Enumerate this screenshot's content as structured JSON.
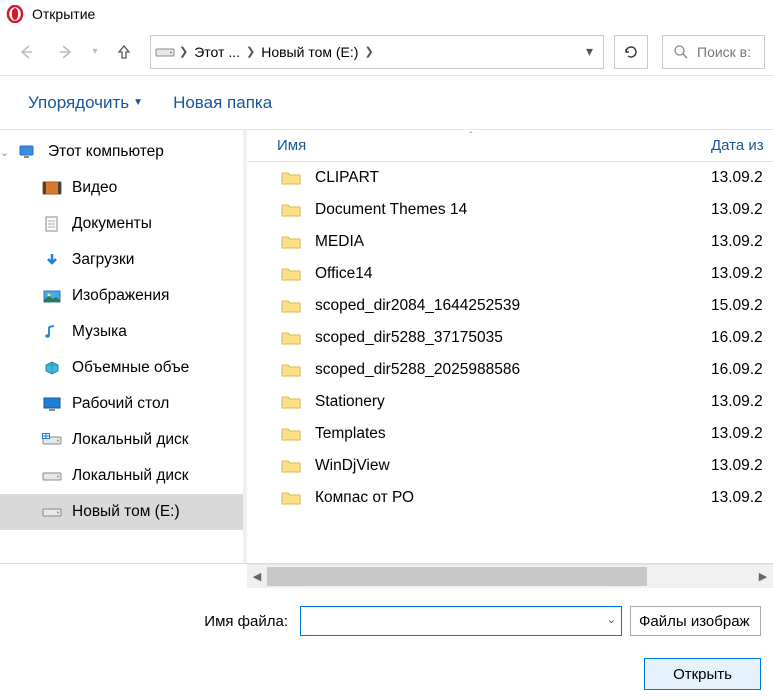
{
  "title": "Открытие",
  "breadcrumb": {
    "pc": "Этот ...",
    "drive": "Новый том (E:)"
  },
  "search_placeholder": "Поиск в: Н",
  "toolbar": {
    "organize": "Упорядочить",
    "newfolder": "Новая папка"
  },
  "headers": {
    "name": "Имя",
    "date": "Дата из"
  },
  "sidebar": [
    {
      "label": "Этот компьютер",
      "icon": "pc",
      "indent": 0
    },
    {
      "label": "Видео",
      "icon": "video",
      "indent": 1
    },
    {
      "label": "Документы",
      "icon": "docs",
      "indent": 1
    },
    {
      "label": "Загрузки",
      "icon": "downloads",
      "indent": 1
    },
    {
      "label": "Изображения",
      "icon": "pictures",
      "indent": 1
    },
    {
      "label": "Музыка",
      "icon": "music",
      "indent": 1
    },
    {
      "label": "Объемные объе",
      "icon": "3d",
      "indent": 1
    },
    {
      "label": "Рабочий стол",
      "icon": "desktop",
      "indent": 1
    },
    {
      "label": "Локальный диск",
      "icon": "drive-os",
      "indent": 1
    },
    {
      "label": "Локальный диск",
      "icon": "drive",
      "indent": 1
    },
    {
      "label": "Новый том (E:)",
      "icon": "drive",
      "indent": 1,
      "selected": true
    }
  ],
  "files": [
    {
      "name": "CLIPART",
      "date": "13.09.2"
    },
    {
      "name": "Document Themes 14",
      "date": "13.09.2"
    },
    {
      "name": "MEDIA",
      "date": "13.09.2"
    },
    {
      "name": "Office14",
      "date": "13.09.2"
    },
    {
      "name": "scoped_dir2084_1644252539",
      "date": "15.09.2"
    },
    {
      "name": "scoped_dir5288_37175035",
      "date": "16.09.2"
    },
    {
      "name": "scoped_dir5288_2025988586",
      "date": "16.09.2"
    },
    {
      "name": "Stationery",
      "date": "13.09.2"
    },
    {
      "name": "Templates",
      "date": "13.09.2"
    },
    {
      "name": "WinDjView",
      "date": "13.09.2"
    },
    {
      "name": "Компас от РО",
      "date": "13.09.2"
    }
  ],
  "filename_label": "Имя файла:",
  "filetype": "Файлы изображ",
  "open_btn": "Открыть"
}
